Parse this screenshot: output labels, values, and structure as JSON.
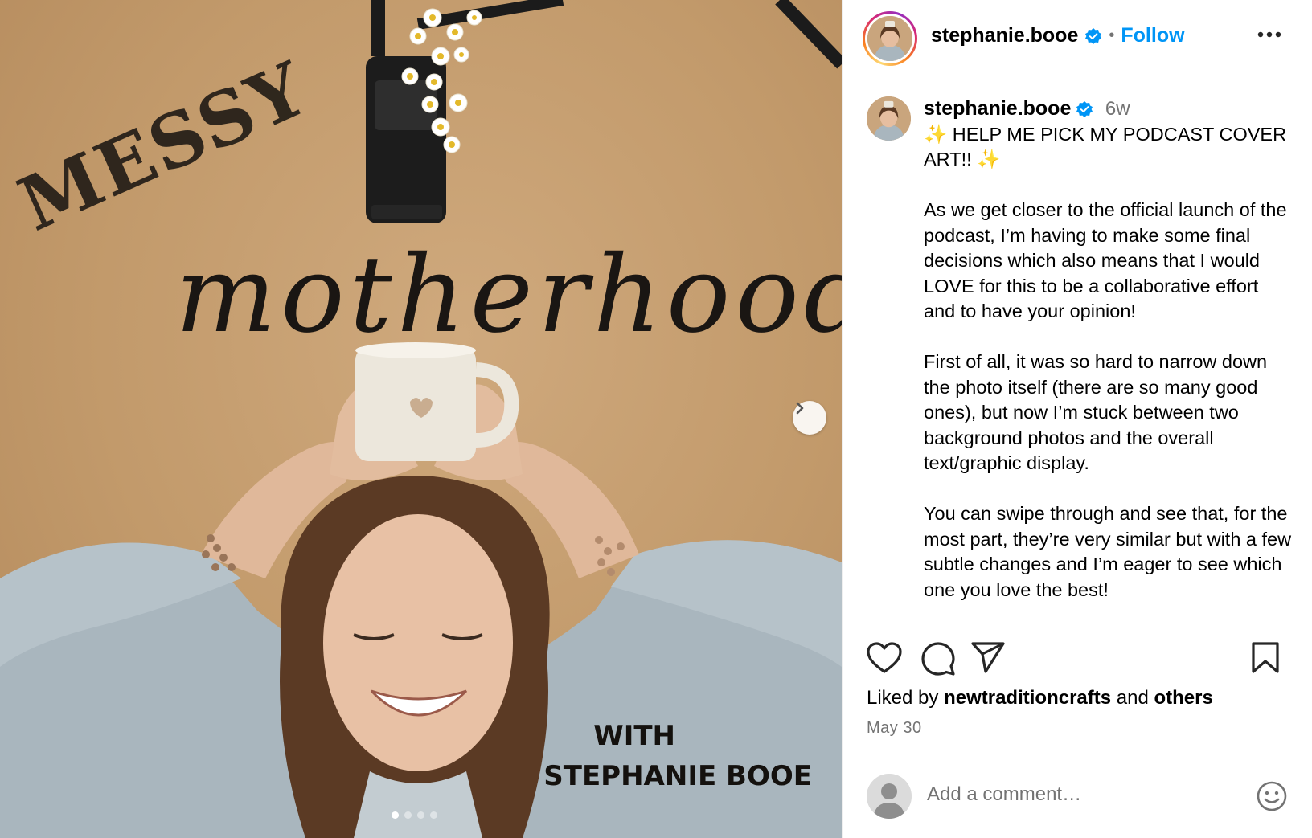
{
  "post": {
    "media": {
      "title_word_1": "MESSY",
      "title_word_2": "motherhood",
      "subtitle_line_1": "WITH",
      "subtitle_line_2": "STEPHANIE BOOE",
      "carousel_total": 4,
      "carousel_active": 1
    },
    "header": {
      "username": "stephanie.booe",
      "separator": "•",
      "follow_label": "Follow"
    },
    "caption": {
      "username": "stephanie.booe",
      "time": "6w",
      "sparkle": "✨",
      "headline": " HELP ME PICK MY PODCAST COVER ART!! ",
      "paragraphs": [
        "As we get closer to the official launch of the podcast, I’m having to make some final decisions which also means that I would LOVE for this to be a collaborative effort and to have your opinion!",
        "First of all, it was so hard to narrow down the photo itself (there are so many good ones), but now I’m stuck between two background photos and the overall text/graphic display.",
        "You can swipe through and see that, for the most part, they’re very similar but with a few subtle changes and I’m eager to see which one you love the best!"
      ]
    },
    "likes": {
      "prefix": "Liked by",
      "user": "newtraditioncrafts",
      "middle": "and",
      "others": "others"
    },
    "date": "May 30",
    "comment": {
      "placeholder": "Add a comment…"
    },
    "colors": {
      "accent": "#0095f6",
      "muted": "#737373",
      "verified": "#0095f6"
    }
  }
}
